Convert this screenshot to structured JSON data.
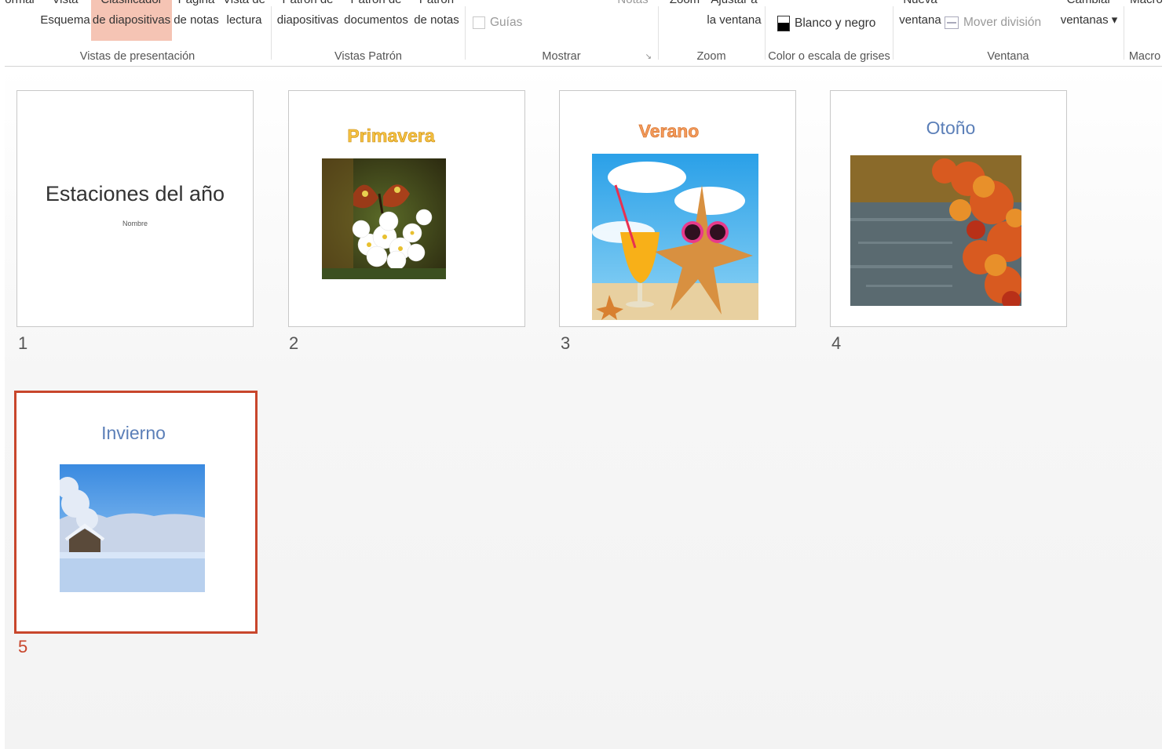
{
  "ribbon": {
    "groups": [
      {
        "label": "Vistas de presentación",
        "buttons": [
          {
            "l1": "ormal",
            "l2": ""
          },
          {
            "l1": "Vista",
            "l2": "Esquema"
          },
          {
            "l1": "Clasificador",
            "l2": "de diapositivas"
          },
          {
            "l1": "Página",
            "l2": "de notas"
          },
          {
            "l1": "Vista de",
            "l2": "lectura"
          }
        ]
      },
      {
        "label": "Vistas Patrón",
        "buttons": [
          {
            "l1": "Patrón de",
            "l2": "diapositivas"
          },
          {
            "l1": "Patrón de",
            "l2": "documentos"
          },
          {
            "l1": "Patrón",
            "l2": "de notas"
          }
        ]
      },
      {
        "label": "Mostrar",
        "guides": "Guías",
        "notes": "Notas"
      },
      {
        "label": "Zoom",
        "buttons": [
          {
            "l1": "Zoom",
            "l2": ""
          },
          {
            "l1": "Ajustar a",
            "l2": "la ventana"
          }
        ]
      },
      {
        "label": "Color o escala de grises",
        "bw": "Blanco y negro"
      },
      {
        "label": "Ventana",
        "buttons": [
          {
            "l1": "Nueva",
            "l2": "ventana"
          },
          {
            "l1": "Cambiar",
            "l2": "ventanas ▾"
          }
        ],
        "move_split": "Mover división"
      },
      {
        "label": "Macro",
        "buttons": [
          {
            "l1": "Macro",
            "l2": ""
          }
        ]
      }
    ]
  },
  "slides": [
    {
      "number": "1",
      "title": "Estaciones del año",
      "subtitle": "Nombre",
      "picture": "",
      "selected": false
    },
    {
      "number": "2",
      "title": "Primavera",
      "picture": "butterfly-blossom-photo",
      "title_color": "#f5c242",
      "selected": false
    },
    {
      "number": "3",
      "title": "Verano",
      "picture": "beach-starfish-photo",
      "title_color": "#f39a5c",
      "selected": false
    },
    {
      "number": "4",
      "title": "Otoño",
      "picture": "autumn-lake-photo",
      "title_color": "#5b7fb8",
      "selected": false
    },
    {
      "number": "5",
      "title": "Invierno",
      "picture": "winter-forest-photo",
      "title_color": "#5b7fb8",
      "selected": true
    }
  ],
  "colors": {
    "selection": "#c8462c",
    "active_view": "#f5c4b4"
  }
}
